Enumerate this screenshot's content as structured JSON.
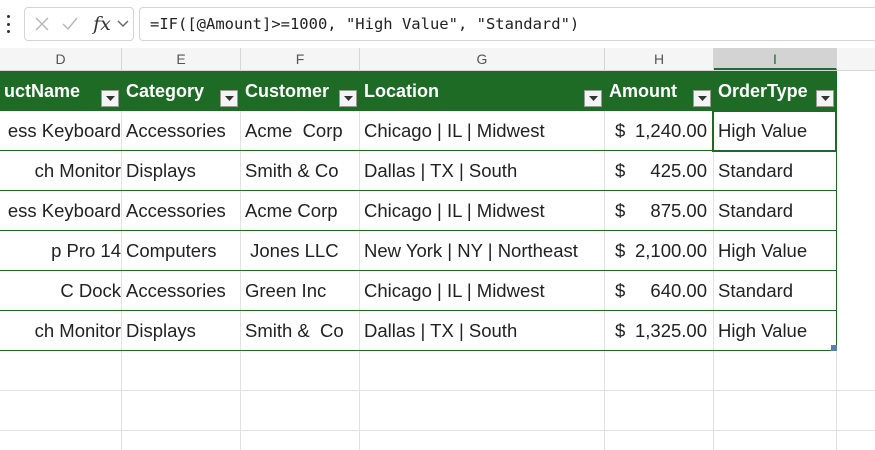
{
  "formula_bar": {
    "formula": "=IF([@Amount]>=1000, \"High Value\", \"Standard\")",
    "cancel_icon": "x-icon",
    "enter_icon": "check-icon",
    "fx_label": "fx"
  },
  "columns": [
    "D",
    "E",
    "F",
    "G",
    "H",
    "I"
  ],
  "selected_column": "I",
  "table": {
    "headers": [
      "uctName",
      "Category",
      "Customer",
      "Location",
      "Amount",
      "OrderType"
    ],
    "rows": [
      {
        "product": "ess Keyboard",
        "category": "Accessories",
        "customer": "Acme  Corp",
        "location": "Chicago | IL | Midwest",
        "currency": "$",
        "amount": "1,240.00",
        "order_type": "High Value"
      },
      {
        "product": "ch Monitor",
        "category": "Displays",
        "customer": "Smith & Co",
        "location": "Dallas | TX | South",
        "currency": "$",
        "amount": "425.00",
        "order_type": "Standard"
      },
      {
        "product": "ess Keyboard",
        "category": "Accessories",
        "customer": "Acme Corp",
        "location": "Chicago | IL | Midwest",
        "currency": "$",
        "amount": "875.00",
        "order_type": "Standard"
      },
      {
        "product": "p Pro 14",
        "category": "Computers",
        "customer": " Jones LLC",
        "location": "New York | NY | Northeast",
        "currency": "$",
        "amount": "2,100.00",
        "order_type": "High Value"
      },
      {
        "product": "C Dock",
        "category": "Accessories",
        "customer": "Green Inc",
        "location": "Chicago | IL | Midwest",
        "currency": "$",
        "amount": "640.00",
        "order_type": "Standard"
      },
      {
        "product": "ch Monitor",
        "category": "Displays",
        "customer": "Smith &  Co",
        "location": "Dallas | TX | South",
        "currency": "$",
        "amount": "1,325.00",
        "order_type": "High Value"
      }
    ]
  },
  "colors": {
    "header_green": "#1e6b26",
    "header_text": "#ffffff",
    "selection_green": "#1e6b26"
  }
}
